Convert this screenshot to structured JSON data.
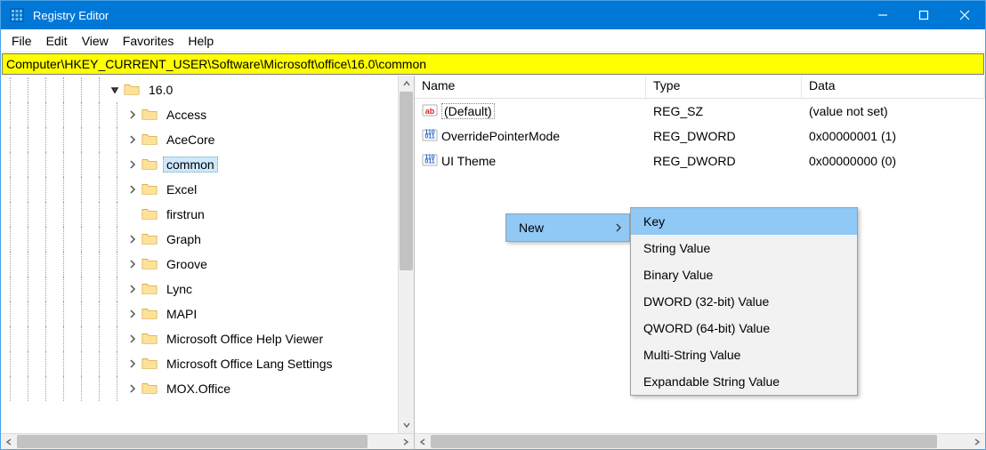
{
  "title": "Registry Editor",
  "menus": [
    "File",
    "Edit",
    "View",
    "Favorites",
    "Help"
  ],
  "address": "Computer\\HKEY_CURRENT_USER\\Software\\Microsoft\\office\\16.0\\common",
  "tree": [
    {
      "label": "16.0",
      "expander": "open",
      "depth": 6,
      "selected": false
    },
    {
      "label": "Access",
      "expander": "closed",
      "depth": 7,
      "selected": false
    },
    {
      "label": "AceCore",
      "expander": "closed",
      "depth": 7,
      "selected": false
    },
    {
      "label": "common",
      "expander": "closed",
      "depth": 7,
      "selected": true
    },
    {
      "label": "Excel",
      "expander": "closed",
      "depth": 7,
      "selected": false
    },
    {
      "label": "firstrun",
      "expander": "none",
      "depth": 7,
      "selected": false
    },
    {
      "label": "Graph",
      "expander": "closed",
      "depth": 7,
      "selected": false
    },
    {
      "label": "Groove",
      "expander": "closed",
      "depth": 7,
      "selected": false
    },
    {
      "label": "Lync",
      "expander": "closed",
      "depth": 7,
      "selected": false
    },
    {
      "label": "MAPI",
      "expander": "closed",
      "depth": 7,
      "selected": false
    },
    {
      "label": "Microsoft Office Help Viewer",
      "expander": "closed",
      "depth": 7,
      "selected": false
    },
    {
      "label": "Microsoft Office Lang Settings",
      "expander": "closed",
      "depth": 7,
      "selected": false
    },
    {
      "label": "MOX.Office",
      "expander": "closed",
      "depth": 7,
      "selected": false
    }
  ],
  "list_headers": {
    "name": "Name",
    "type": "Type",
    "data": "Data"
  },
  "list_rows": [
    {
      "icon": "string",
      "name": "(Default)",
      "type": "REG_SZ",
      "data": "(value not set)",
      "dotted": true
    },
    {
      "icon": "binary",
      "name": "OverridePointerMode",
      "type": "REG_DWORD",
      "data": "0x00000001 (1)",
      "dotted": false
    },
    {
      "icon": "binary",
      "name": "UI Theme",
      "type": "REG_DWORD",
      "data": "0x00000000 (0)",
      "dotted": false
    }
  ],
  "context_menu": {
    "label": "New"
  },
  "submenu": [
    {
      "label": "Key",
      "hover": true
    },
    {
      "label": "String Value",
      "hover": false
    },
    {
      "label": "Binary Value",
      "hover": false
    },
    {
      "label": "DWORD (32-bit) Value",
      "hover": false
    },
    {
      "label": "QWORD (64-bit) Value",
      "hover": false
    },
    {
      "label": "Multi-String Value",
      "hover": false
    },
    {
      "label": "Expandable String Value",
      "hover": false
    }
  ]
}
